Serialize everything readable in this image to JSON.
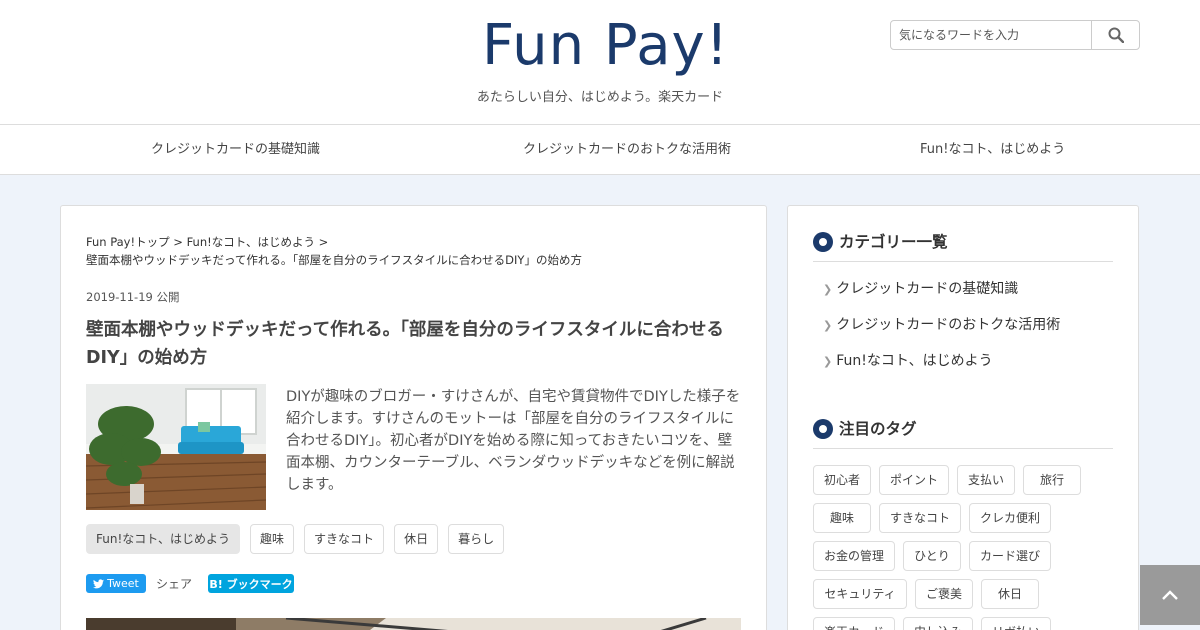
{
  "site": {
    "logo_text": "Fun Pay!",
    "tagline": "あたらしい自分、はじめよう。楽天カード",
    "search_placeholder": "気になるワードを入力",
    "search_icon": "search-icon"
  },
  "nav": {
    "items": [
      {
        "label": "クレジットカードの基礎知識"
      },
      {
        "label": "クレジットカードのおトクな活用術"
      },
      {
        "label": "Fun!なコト、はじめよう"
      }
    ]
  },
  "article": {
    "breadcrumb": {
      "home": "Fun Pay!トップ",
      "sep1": " > ",
      "category": "Fun!なコト、はじめよう",
      "sep2": " > ",
      "current": "壁面本棚やウッドデッキだって作れる。「部屋を自分のライフスタイルに合わせるDIY」の始め方"
    },
    "date": "2019-11-19",
    "date_suffix": "公開",
    "title": "壁面本棚やウッドデッキだって作れる。「部屋を自分のライフスタイルに合わせるDIY」の始め方",
    "excerpt": "DIYが趣味のブロガー・すけさんが、自宅や賃貸物件でDIYした様子を紹介します。すけさんのモットーは「部屋を自分のライフスタイルに合わせるDIY」。初心者がDIYを始める際に知っておきたいコツを、壁面本棚、カウンターテーブル、ベランダウッドデッキなどを例に解説します。",
    "category_tag": "Fun!なコト、はじめよう",
    "tags": [
      "趣味",
      "すきなコト",
      "休日",
      "暮らし"
    ],
    "share": {
      "tweet_label": "Tweet",
      "share_label": "シェア",
      "hatena_label": "B! ブックマーク"
    }
  },
  "sidebar": {
    "categories_heading": "カテゴリー一覧",
    "categories": [
      {
        "label": "クレジットカードの基礎知識"
      },
      {
        "label": "クレジットカードのおトクな活用術"
      },
      {
        "label": "Fun!なコト、はじめよう"
      }
    ],
    "tags_heading": "注目のタグ",
    "tags": [
      "初心者",
      "ポイント",
      "支払い",
      "旅行",
      "趣味",
      "すきなコト",
      "クレカ便利",
      "お金の管理",
      "ひとり",
      "カード選び",
      "セキュリティ",
      "ご褒美",
      "休日",
      "楽天カード",
      "申し込み",
      "リボ払い"
    ]
  },
  "colors": {
    "brand_navy": "#1b3a6b",
    "twitter_blue": "#1d9bf0",
    "hatena_blue": "#00a4de",
    "page_bg": "#eef3fa"
  }
}
